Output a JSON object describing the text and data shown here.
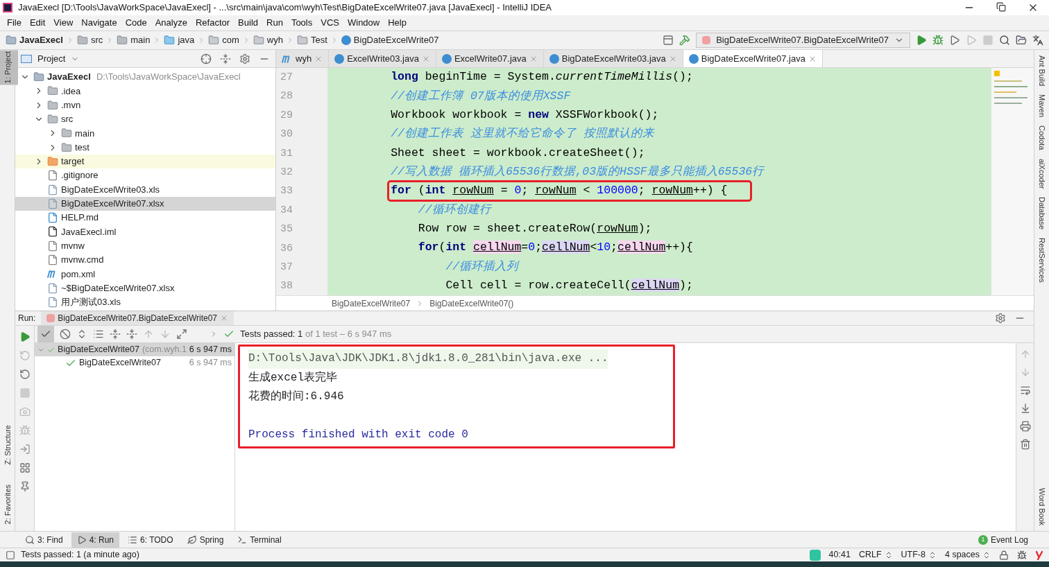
{
  "window": {
    "title": "JavaExecl [D:\\Tools\\JavaWorkSpace\\JavaExecl] - ...\\src\\main\\java\\com\\wyh\\Test\\BigDateExcelWrite07.java [JavaExecl] - IntelliJ IDEA"
  },
  "menu": [
    "File",
    "Edit",
    "View",
    "Navigate",
    "Code",
    "Analyze",
    "Refactor",
    "Build",
    "Run",
    "Tools",
    "VCS",
    "Window",
    "Help"
  ],
  "nav_path": [
    {
      "label": "JavaExecl",
      "kind": "project"
    },
    {
      "label": "src",
      "kind": "folder"
    },
    {
      "label": "main",
      "kind": "folder"
    },
    {
      "label": "java",
      "kind": "source"
    },
    {
      "label": "com",
      "kind": "package"
    },
    {
      "label": "wyh",
      "kind": "package"
    },
    {
      "label": "Test",
      "kind": "package"
    },
    {
      "label": "BigDateExcelWrite07",
      "kind": "class"
    }
  ],
  "run_config": "BigDateExcelWrite07.BigDateExcelWrite07",
  "left_tools": [
    {
      "label": "1: Project",
      "selected": true
    },
    {
      "label": "Z: Structure",
      "selected": false
    },
    {
      "label": "2: Favorites",
      "selected": false
    }
  ],
  "right_tools": [
    "Ant Build",
    "Maven",
    "Codota",
    "aiXcoder",
    "Database",
    "RestServices",
    "Word Book"
  ],
  "project": {
    "title": "Project",
    "tree": [
      {
        "name": "JavaExecl",
        "path": "D:\\Tools\\JavaWorkSpace\\JavaExecl",
        "kind": "project",
        "expanded": true,
        "selected": false,
        "excluded": false,
        "children": [
          {
            "name": ".idea",
            "kind": "folder",
            "expanded": false,
            "selected": false,
            "excluded": false
          },
          {
            "name": ".mvn",
            "kind": "folder",
            "expanded": false,
            "selected": false,
            "excluded": false
          },
          {
            "name": "src",
            "kind": "folder",
            "expanded": true,
            "selected": false,
            "excluded": false,
            "children": [
              {
                "name": "main",
                "kind": "folder",
                "expanded": false,
                "selected": false,
                "excluded": false
              },
              {
                "name": "test",
                "kind": "folder",
                "expanded": false,
                "selected": false,
                "excluded": false
              }
            ]
          },
          {
            "name": "target",
            "kind": "folder",
            "expanded": false,
            "selected": false,
            "excluded": true
          },
          {
            "name": ".gitignore",
            "kind": "file",
            "selected": false,
            "excluded": false
          },
          {
            "name": "BigDateExcelWrite03.xls",
            "kind": "unknown",
            "selected": false,
            "excluded": false
          },
          {
            "name": "BigDateExcelWrite07.xlsx",
            "kind": "unknown",
            "selected": true,
            "excluded": false
          },
          {
            "name": "HELP.md",
            "kind": "markdown",
            "selected": false,
            "excluded": false
          },
          {
            "name": "JavaExecl.iml",
            "kind": "module",
            "selected": false,
            "excluded": false
          },
          {
            "name": "mvnw",
            "kind": "file",
            "selected": false,
            "excluded": false
          },
          {
            "name": "mvnw.cmd",
            "kind": "file",
            "selected": false,
            "excluded": false
          },
          {
            "name": "pom.xml",
            "kind": "maven",
            "selected": false,
            "excluded": false
          },
          {
            "name": "~$BigDateExcelWrite07.xlsx",
            "kind": "unknown",
            "selected": false,
            "excluded": false
          },
          {
            "name": "用户测试03.xls",
            "kind": "unknown",
            "selected": false,
            "excluded": false
          }
        ]
      }
    ]
  },
  "editor": {
    "tabs": [
      {
        "label": "wyh",
        "kind": "maven",
        "selected": false
      },
      {
        "label": "ExcelWrite03.java",
        "kind": "class",
        "selected": false
      },
      {
        "label": "ExcelWrite07.java",
        "kind": "class",
        "selected": false
      },
      {
        "label": "BigDateExcelWrite03.java",
        "kind": "class",
        "selected": false
      },
      {
        "label": "BigDateExcelWrite07.java",
        "kind": "class",
        "selected": true
      }
    ],
    "lines": [
      {
        "number": "27",
        "highlighted": false,
        "segments": [
          {
            "kind": "keyword",
            "text": "long"
          },
          {
            "kind": "plain",
            "text": " beginTime = System."
          },
          {
            "kind": "static",
            "text": "currentTimeMillis"
          },
          {
            "kind": "plain",
            "text": "();"
          }
        ]
      },
      {
        "number": "28",
        "highlighted": false,
        "segments": [
          {
            "kind": "comment",
            "text": "//创建工作簿 07版本的使用XSSF"
          }
        ]
      },
      {
        "number": "29",
        "highlighted": false,
        "segments": [
          {
            "kind": "plain",
            "text": "Workbook workbook = "
          },
          {
            "kind": "keyword",
            "text": "new"
          },
          {
            "kind": "plain",
            "text": " XSSFWorkbook();"
          }
        ]
      },
      {
        "number": "30",
        "highlighted": false,
        "segments": [
          {
            "kind": "comment",
            "text": "//创建工作表 这里就不给它命令了 按照默认的来"
          }
        ]
      },
      {
        "number": "31",
        "highlighted": false,
        "segments": [
          {
            "kind": "plain",
            "text": "Sheet sheet = workbook.createSheet();"
          }
        ]
      },
      {
        "number": "32",
        "highlighted": false,
        "segments": [
          {
            "kind": "comment",
            "text": "//写入数据 循环插入65536行数据,03版的HSSF最多只能插入65536行"
          }
        ]
      },
      {
        "number": "33",
        "highlighted": true,
        "segments": [
          {
            "kind": "keyword",
            "text": "for"
          },
          {
            "kind": "plain",
            "text": " ("
          },
          {
            "kind": "keyword",
            "text": "int "
          },
          {
            "kind": "variable",
            "text": "rowNum"
          },
          {
            "kind": "plain",
            "text": " = "
          },
          {
            "kind": "number",
            "text": "0"
          },
          {
            "kind": "plain",
            "text": "; "
          },
          {
            "kind": "variable",
            "text": "rowNum"
          },
          {
            "kind": "plain",
            "text": " < "
          },
          {
            "kind": "number",
            "text": "100000"
          },
          {
            "kind": "plain",
            "text": "; "
          },
          {
            "kind": "variable",
            "text": "rowNum"
          },
          {
            "kind": "plain",
            "text": "++) {"
          }
        ],
        "children": [
          {
            "number": "34",
            "highlighted": false,
            "segments": [
              {
                "kind": "comment",
                "text": "//循环创建行"
              }
            ]
          },
          {
            "number": "35",
            "highlighted": false,
            "segments": [
              {
                "kind": "plain",
                "text": "Row row = sheet.createRow("
              },
              {
                "kind": "variable",
                "text": "rowNum"
              },
              {
                "kind": "plain",
                "text": ");"
              }
            ]
          },
          {
            "number": "36",
            "highlighted": false,
            "segments": [
              {
                "kind": "keyword",
                "text": "for"
              },
              {
                "kind": "plain",
                "text": "("
              },
              {
                "kind": "keyword",
                "text": "int "
              },
              {
                "kind": "write",
                "text": "cellNum"
              },
              {
                "kind": "plain",
                "text": "="
              },
              {
                "kind": "number",
                "text": "0"
              },
              {
                "kind": "plain",
                "text": ";"
              },
              {
                "kind": "read",
                "text": "cellNum"
              },
              {
                "kind": "plain",
                "text": "<"
              },
              {
                "kind": "number",
                "text": "10"
              },
              {
                "kind": "plain",
                "text": ";"
              },
              {
                "kind": "write",
                "text": "cellNum"
              },
              {
                "kind": "plain",
                "text": "++){"
              }
            ],
            "children": [
              {
                "number": "37",
                "highlighted": false,
                "segments": [
                  {
                    "kind": "comment",
                    "text": "//循环插入列"
                  }
                ]
              },
              {
                "number": "38",
                "highlighted": false,
                "segments": [
                  {
                    "kind": "plain",
                    "text": "Cell cell = row.createCell("
                  },
                  {
                    "kind": "read",
                    "text": "cellNum"
                  },
                  {
                    "kind": "plain",
                    "text": ");"
                  }
                ]
              }
            ]
          }
        ]
      }
    ],
    "breadcrumb": [
      "BigDateExcelWrite07",
      "BigDateExcelWrite07()"
    ]
  },
  "run": {
    "label": "Run:",
    "tab": "BigDateExcelWrite07.BigDateExcelWrite07",
    "status_strong": "Tests passed: 1",
    "status_rest": "of 1 test – 6 s 947 ms",
    "tests": [
      {
        "name": "BigDateExcelWrite07",
        "detail": "(com.wyh.1",
        "time": "6 s 947 ms",
        "selected": true,
        "children": [
          {
            "name": "BigDateExcelWrite07",
            "time": "6 s 947 ms",
            "selected": false
          }
        ]
      }
    ],
    "console": {
      "outlined": true,
      "lines": [
        {
          "kind": "command",
          "text": "D:\\Tools\\Java\\JDK\\JDK1.8\\jdk1.8.0_281\\bin\\java.exe ..."
        },
        {
          "kind": "output",
          "text": "生成excel表完毕"
        },
        {
          "kind": "output",
          "text": "花费的时间:6.946"
        },
        {
          "kind": "blank"
        },
        {
          "kind": "exit",
          "text": "Process finished with exit code 0"
        }
      ]
    }
  },
  "bottom_tabs": [
    {
      "label": "3: Find",
      "kind": "find",
      "selected": false
    },
    {
      "label": "4: Run",
      "kind": "run",
      "selected": true
    },
    {
      "label": "6: TODO",
      "kind": "todo",
      "selected": false
    },
    {
      "label": "Spring",
      "kind": "spring",
      "selected": false
    },
    {
      "label": "Terminal",
      "kind": "terminal",
      "selected": false
    }
  ],
  "event_log": {
    "label": "Event Log",
    "count": "1"
  },
  "status_bar": {
    "message": "Tests passed: 1 (a minute ago)",
    "position": "40:41",
    "line_ending": "CRLF",
    "encoding": "UTF-8",
    "indent": "4 spaces"
  }
}
